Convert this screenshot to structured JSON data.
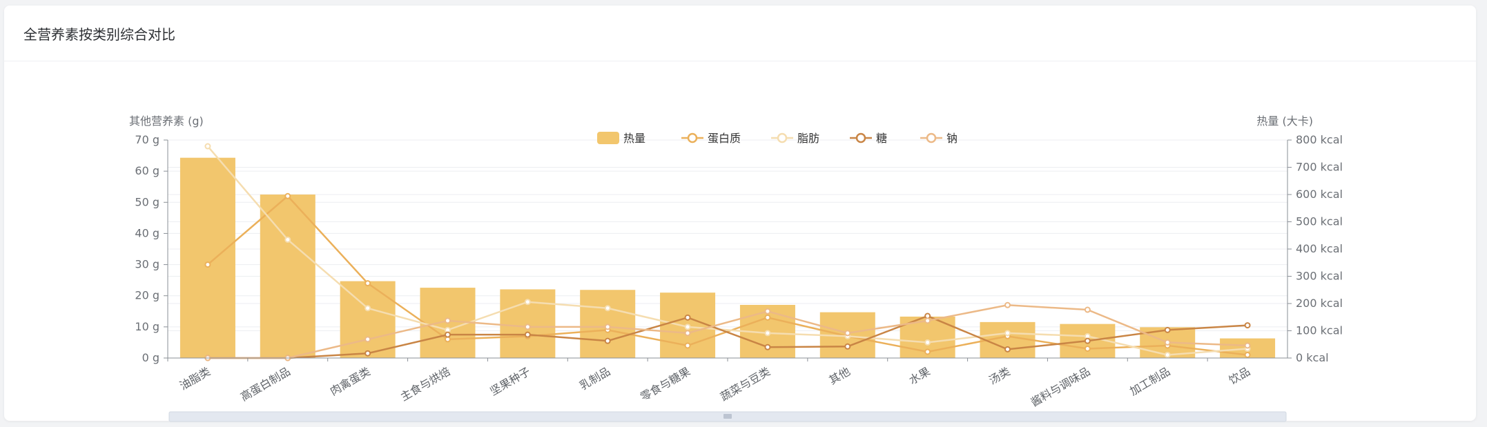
{
  "card": {
    "title": "全营养素按类别综合对比"
  },
  "colors": {
    "heat": "#f2c66d",
    "protein": "#ebb05a",
    "fat": "#f5ddb0",
    "sugar": "#c98545",
    "sodium": "#ecb987",
    "grid": "#eceef1",
    "axis": "#8a8f96"
  },
  "chart_data": {
    "type": "bar",
    "categories": [
      "油脂类",
      "高蛋白制品",
      "肉禽蛋类",
      "主食与烘焙",
      "坚果种子",
      "乳制品",
      "零食与糖果",
      "蔬菜与豆类",
      "其他",
      "水果",
      "汤类",
      "酱料与调味品",
      "加工制品",
      "饮品"
    ],
    "left_axis": {
      "name": "其他营养素 (g)",
      "ticks": [
        "0 g",
        "10 g",
        "20 g",
        "30 g",
        "40 g",
        "50 g",
        "60 g",
        "70 g"
      ],
      "range": [
        0,
        70
      ]
    },
    "right_axis": {
      "name": "热量 (大卡)",
      "ticks": [
        "0 kcal",
        "100 kcal",
        "200 kcal",
        "300 kcal",
        "400 kcal",
        "500 kcal",
        "600 kcal",
        "700 kcal",
        "800 kcal"
      ],
      "range": [
        0,
        800
      ]
    },
    "legend": {
      "placement": "top-center"
    },
    "grid": true,
    "series": [
      {
        "name": "热量",
        "type": "bar",
        "axis": "right",
        "color_key": "heat",
        "values": [
          735,
          600,
          282,
          258,
          252,
          250,
          240,
          195,
          168,
          152,
          132,
          125,
          113,
          72
        ]
      },
      {
        "name": "蛋白质",
        "type": "line",
        "axis": "left",
        "color_key": "protein",
        "values": [
          30,
          52,
          24,
          6,
          7,
          9,
          4,
          13,
          7,
          2,
          7,
          3,
          4,
          1
        ]
      },
      {
        "name": "脂肪",
        "type": "line",
        "axis": "left",
        "color_key": "fat",
        "values": [
          68,
          38,
          16,
          9,
          18,
          16,
          10,
          8,
          7,
          5,
          8,
          7,
          1,
          3
        ]
      },
      {
        "name": "糖",
        "type": "line",
        "axis": "left",
        "color_key": "sugar",
        "values": [
          0,
          0,
          1.5,
          7.5,
          7.5,
          5.5,
          13,
          3.5,
          3.7,
          13.5,
          2.8,
          5.5,
          9,
          10.5
        ]
      },
      {
        "name": "钠",
        "type": "line",
        "axis": "left",
        "color_key": "sodium",
        "values": [
          0,
          0,
          6,
          12,
          10,
          10,
          8,
          15,
          8,
          12,
          17,
          15.5,
          5,
          4
        ]
      }
    ]
  }
}
